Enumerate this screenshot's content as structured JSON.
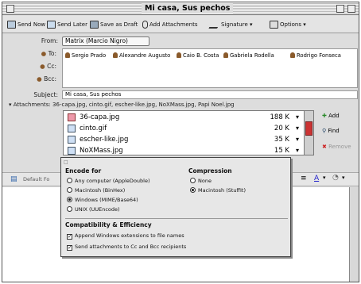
{
  "window": {
    "title": "Mi casa, Sus pechos"
  },
  "toolbar": {
    "send_now": "Send Now",
    "send_later": "Send Later",
    "save_draft": "Save as Draft",
    "add_attachments": "Add Attachments",
    "signature": "Signature",
    "options": "Options"
  },
  "header": {
    "from_label": "From:",
    "from_value": "Matrix (Marcio Nigro)",
    "to_label": "To:",
    "cc_label": "Cc:",
    "bcc_label": "Bcc:",
    "recipients": [
      "Sergio Prado",
      "Alexandre Augusto",
      "Caio B. Costa",
      "Gabriela Rodella",
      "Rodrigo Fonseca"
    ],
    "subject_label": "Subject:",
    "subject_value": "Mi casa, Sus pechos",
    "attachments_label": "Attachments:",
    "attachments_value": "36-capa.jpg, cinto.gif, escher-like.jpg, NoXMass.jpg, Papi Noel.jpg"
  },
  "files": [
    {
      "name": "36-capa.jpg",
      "size": "188 K"
    },
    {
      "name": "cinto.gif",
      "size": "20 K"
    },
    {
      "name": "escher-like.jpg",
      "size": "35 K"
    },
    {
      "name": "NoXMass.jpg",
      "size": "15 K"
    }
  ],
  "side_buttons": {
    "add": "Add",
    "find": "Find",
    "remove": "Remove"
  },
  "encode": {
    "title": "Encode for",
    "options": [
      "Any computer (AppleDouble)",
      "Macintosh (BinHex)",
      "Windows (MIME/Base64)",
      "UNIX (UUEncode)"
    ],
    "selected": "Windows (MIME/Base64)"
  },
  "compression": {
    "title": "Compression",
    "options": [
      "None",
      "Macintosh (StuffIt)"
    ],
    "selected": "Macintosh (StuffIt)"
  },
  "compat": {
    "title": "Compatibility & Efficiency",
    "append_ext": "Append Windows extensions to file names",
    "send_cc": "Send attachments to Cc and Bcc recipients"
  },
  "format_bar": {
    "font": "Default Fo"
  },
  "colors": {
    "title_stripe": "#bdbdbd",
    "thumb": "#cc3333",
    "remove_red": "#cc2222"
  }
}
